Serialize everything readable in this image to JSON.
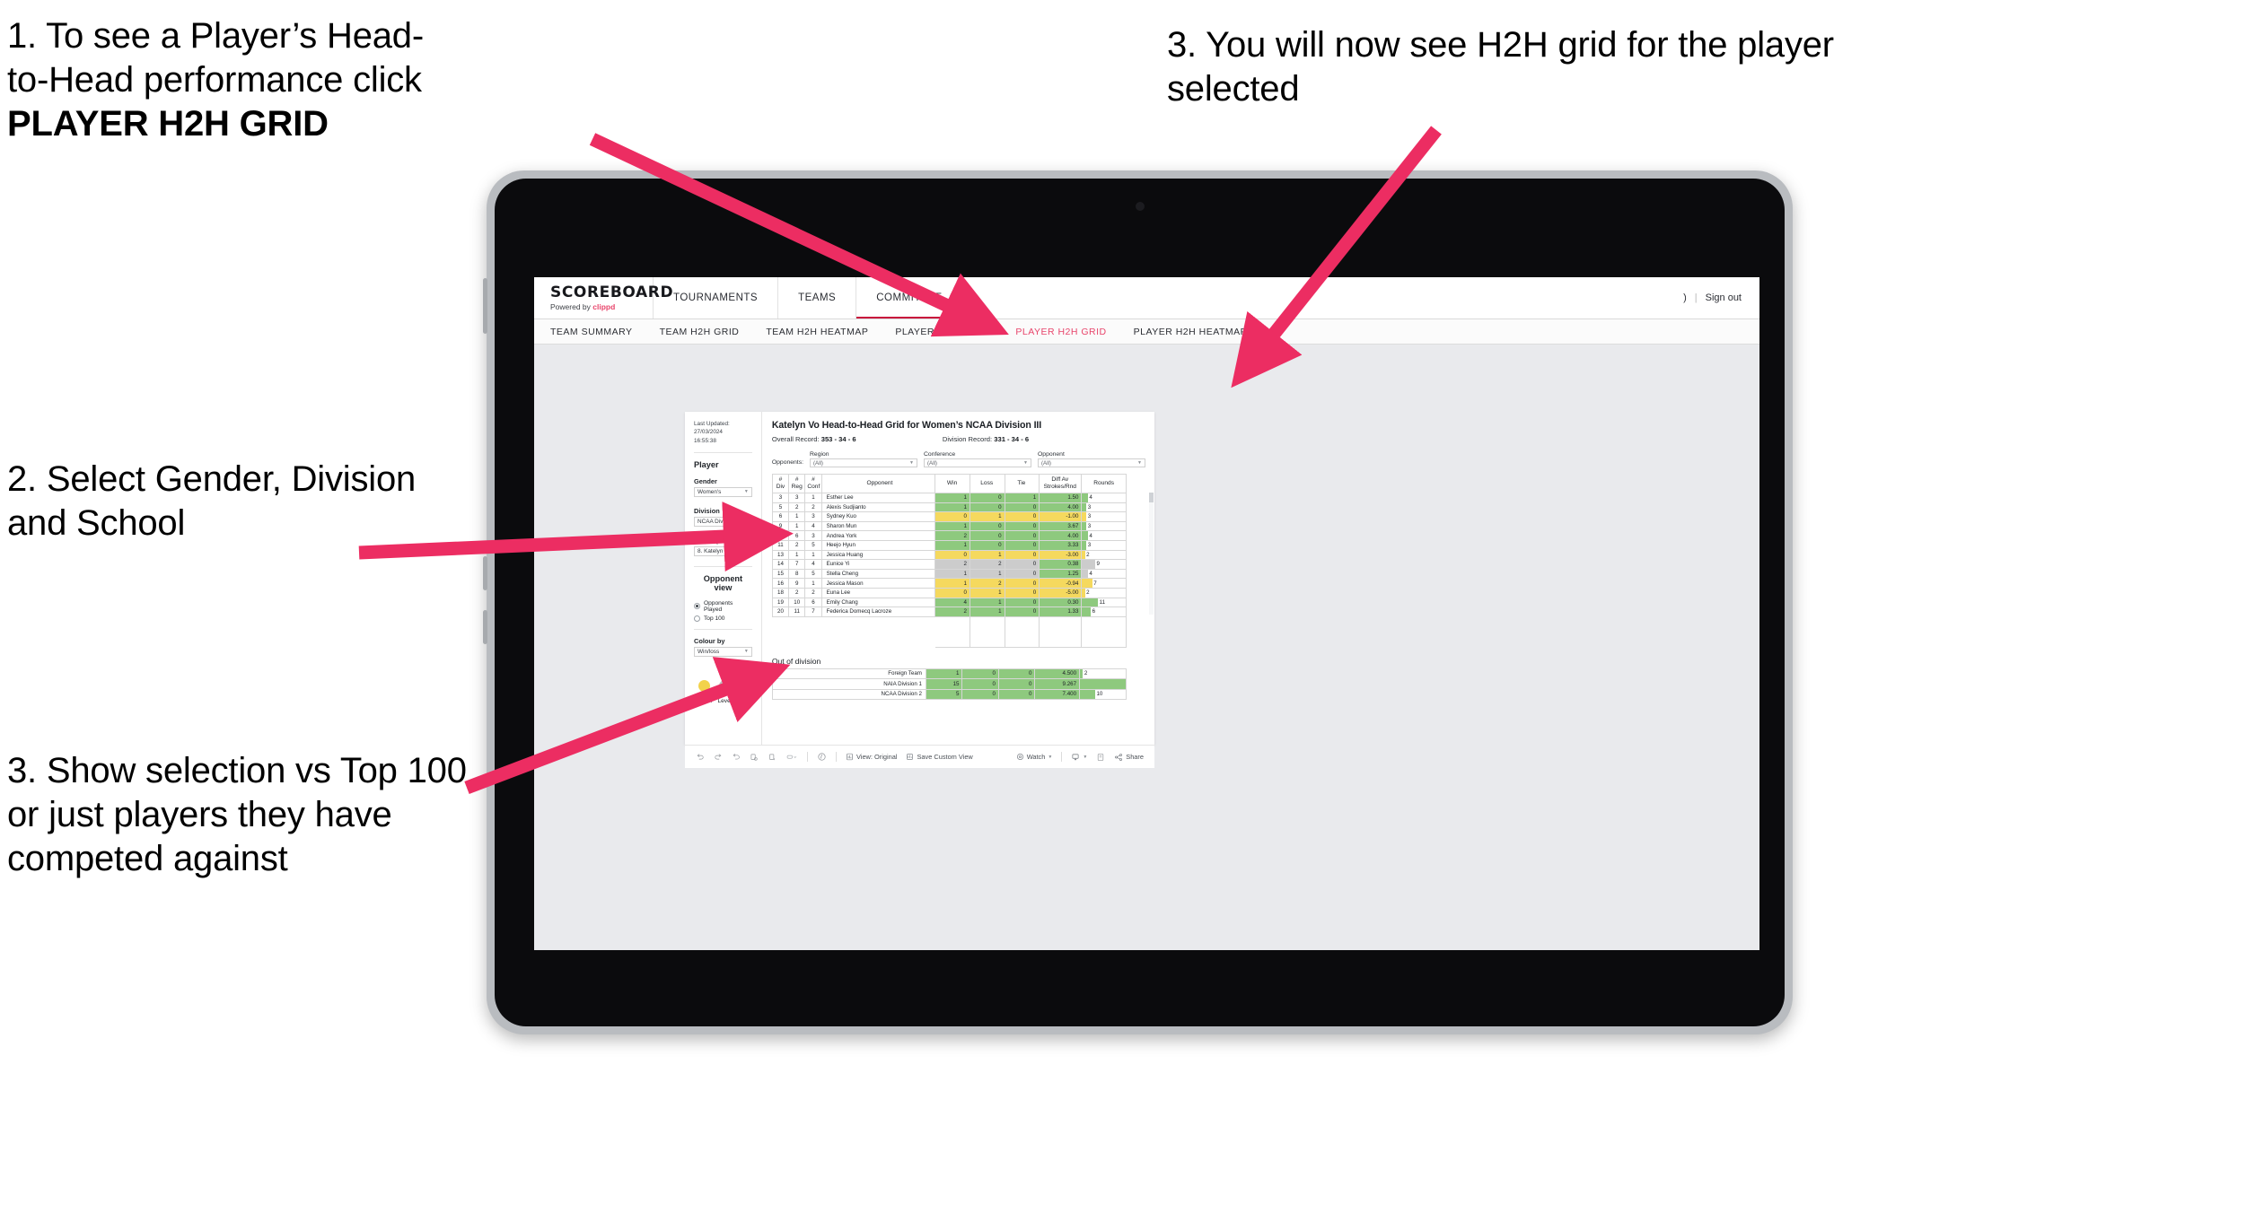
{
  "annotations": {
    "callout1_line1": "1. To see a Player’s Head-",
    "callout1_line2": "to-Head performance click",
    "callout1_bold": "PLAYER H2H GRID",
    "callout2": "2. Select Gender, Division and School",
    "callout3": "3. Show selection vs Top 100 or just players they have competed against",
    "callout4": "3. You will now see H2H grid for the player selected",
    "arrow_color": "#ec2d62"
  },
  "app_header": {
    "brand_name": "SCOREBOARD",
    "brand_sub_prefix": "Powered by ",
    "brand_sub_brand": "clippd",
    "nav": [
      {
        "label": "TOURNAMENTS",
        "active": false
      },
      {
        "label": "TEAMS",
        "active": false
      },
      {
        "label": "COMMITTEE",
        "active": true
      }
    ],
    "account_glyph": ")",
    "separator": "|",
    "sign_out": "Sign out"
  },
  "subnav": {
    "tabs": [
      {
        "label": "TEAM SUMMARY",
        "active": false
      },
      {
        "label": "TEAM H2H GRID",
        "active": false
      },
      {
        "label": "TEAM H2H HEATMAP",
        "active": false
      },
      {
        "label": "PLAYER SUMMARY",
        "active": false
      },
      {
        "label": "PLAYER H2H GRID",
        "active": true
      },
      {
        "label": "PLAYER H2H HEATMAP",
        "active": false
      }
    ],
    "active_color": "#e8456b"
  },
  "sidebar": {
    "last_updated_line1": "Last Updated: 27/03/2024",
    "last_updated_line2": "16:55:38",
    "player_heading": "Player",
    "fields": [
      {
        "label": "Gender",
        "value": "Women's"
      },
      {
        "label": "Division",
        "value": "NCAA Division III"
      },
      {
        "label": "Player (Rank)",
        "value": "8. Katelyn Vo"
      }
    ],
    "opponent_view_heading": "Opponent view",
    "opponent_view_options": [
      {
        "label": "Opponents Played",
        "selected": true
      },
      {
        "label": "Top 100",
        "selected": false
      }
    ],
    "colour_by_label": "Colour by",
    "colour_by_value": "Win/loss",
    "legend": [
      {
        "label": "Down",
        "color": "#f2d24b"
      },
      {
        "label": "Level",
        "color": "#bcbdbf"
      },
      {
        "label": "Up",
        "color": "#6fc04a"
      }
    ]
  },
  "main": {
    "title": "Katelyn Vo Head-to-Head Grid for Women’s NCAA Division III",
    "overall_record_label": "Overall Record:",
    "overall_record_value": "353 -  34 - 6",
    "division_record_label": "Division Record:",
    "division_record_value": "331 -  34 - 6",
    "opponents_label": "Opponents:",
    "opponent_filters": [
      {
        "label": "Region",
        "value": "(All)"
      },
      {
        "label": "Conference",
        "value": "(All)"
      },
      {
        "label": "Opponent",
        "value": "(All)"
      }
    ],
    "out_of_division_title": "Out of division"
  },
  "chart_data": {
    "type": "table",
    "title": "Katelyn Vo Head-to-Head Grid for Women’s NCAA Division III",
    "columns": [
      "# Div",
      "# Reg",
      "# Conf",
      "Opponent",
      "Win",
      "Loss",
      "Tie",
      "Diff Av Strokes/Rnd",
      "Rounds"
    ],
    "column_header_lines": [
      [
        "#",
        "Div"
      ],
      [
        "#",
        "Reg"
      ],
      [
        "#",
        "Conf"
      ],
      [
        "Opponent"
      ],
      [
        "Win"
      ],
      [
        "Loss"
      ],
      [
        "Tie"
      ],
      [
        "Diff Av",
        "Strokes/Rnd"
      ],
      [
        "Rounds"
      ]
    ],
    "colors": {
      "up": "#8ec97e",
      "down": "#f5d95e",
      "level": "#cccccc",
      "none": "#ffffff"
    },
    "rounds_max": 30,
    "rows": [
      {
        "div": "3",
        "reg": "3",
        "conf": "1",
        "opponent": "Esther Lee",
        "win": "1",
        "loss": "0",
        "tie": "1",
        "diff": "1.50",
        "rounds": "4",
        "state": "up"
      },
      {
        "div": "5",
        "reg": "2",
        "conf": "2",
        "opponent": "Alexis Sudjianto",
        "win": "1",
        "loss": "0",
        "tie": "0",
        "diff": "4.00",
        "rounds": "3",
        "state": "up"
      },
      {
        "div": "6",
        "reg": "1",
        "conf": "3",
        "opponent": "Sydney Kuo",
        "win": "0",
        "loss": "1",
        "tie": "0",
        "diff": "-1.00",
        "rounds": "3",
        "state": "down"
      },
      {
        "div": "9",
        "reg": "1",
        "conf": "4",
        "opponent": "Sharon Mun",
        "win": "1",
        "loss": "0",
        "tie": "0",
        "diff": "3.67",
        "rounds": "3",
        "state": "up"
      },
      {
        "div": "10",
        "reg": "6",
        "conf": "3",
        "opponent": "Andrea York",
        "win": "2",
        "loss": "0",
        "tie": "0",
        "diff": "4.00",
        "rounds": "4",
        "state": "up"
      },
      {
        "div": "11",
        "reg": "2",
        "conf": "5",
        "opponent": "Heejo Hyun",
        "win": "1",
        "loss": "0",
        "tie": "0",
        "diff": "3.33",
        "rounds": "3",
        "state": "up"
      },
      {
        "div": "13",
        "reg": "1",
        "conf": "1",
        "opponent": "Jessica Huang",
        "win": "0",
        "loss": "1",
        "tie": "0",
        "diff": "-3.00",
        "rounds": "2",
        "state": "down"
      },
      {
        "div": "14",
        "reg": "7",
        "conf": "4",
        "opponent": "Eunice Yi",
        "win": "2",
        "loss": "2",
        "tie": "0",
        "diff": "0.38",
        "rounds": "9",
        "state": "level",
        "diff_state": "up"
      },
      {
        "div": "15",
        "reg": "8",
        "conf": "5",
        "opponent": "Stella Cheng",
        "win": "1",
        "loss": "1",
        "tie": "0",
        "diff": "1.25",
        "rounds": "4",
        "state": "level",
        "diff_state": "up"
      },
      {
        "div": "16",
        "reg": "9",
        "conf": "1",
        "opponent": "Jessica Mason",
        "win": "1",
        "loss": "2",
        "tie": "0",
        "diff": "-0.94",
        "rounds": "7",
        "state": "down"
      },
      {
        "div": "18",
        "reg": "2",
        "conf": "2",
        "opponent": "Euna Lee",
        "win": "0",
        "loss": "1",
        "tie": "0",
        "diff": "-5.00",
        "rounds": "2",
        "state": "down"
      },
      {
        "div": "19",
        "reg": "10",
        "conf": "6",
        "opponent": "Emily Chang",
        "win": "4",
        "loss": "1",
        "tie": "0",
        "diff": "0.30",
        "rounds": "11",
        "state": "up"
      },
      {
        "div": "20",
        "reg": "11",
        "conf": "7",
        "opponent": "Federica Domecq Lacroze",
        "win": "2",
        "loss": "1",
        "tie": "0",
        "diff": "1.33",
        "rounds": "6",
        "state": "up"
      }
    ],
    "out_of_division": {
      "rounds_max": 30,
      "rows": [
        {
          "name": "Foreign Team",
          "win": "1",
          "loss": "0",
          "tie": "0",
          "diff": "4.500",
          "rounds": "2",
          "state": "up"
        },
        {
          "name": "NAIA Division 1",
          "win": "15",
          "loss": "0",
          "tie": "0",
          "diff": "9.267",
          "rounds": "30",
          "state": "up"
        },
        {
          "name": "NCAA Division 2",
          "win": "5",
          "loss": "0",
          "tie": "0",
          "diff": "7.400",
          "rounds": "10",
          "state": "up"
        }
      ]
    }
  },
  "toolbar": {
    "view_original": "View: Original",
    "save_custom_view": "Save Custom View",
    "watch": "Watch",
    "share": "Share"
  }
}
